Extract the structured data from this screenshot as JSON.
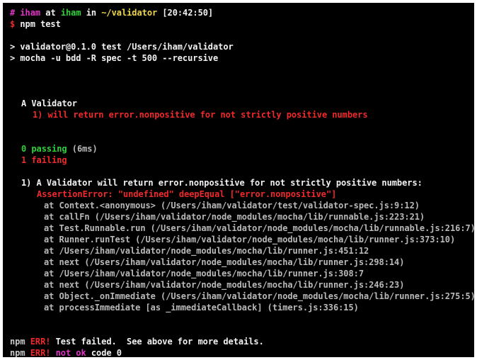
{
  "prompt": {
    "hash": "#",
    "user": "iham",
    "at": "at",
    "host": "iham",
    "in": "in",
    "cwd": "~/validator",
    "time": "[20:42:50]",
    "dollar": "$",
    "command": "npm test"
  },
  "script_header": [
    "> validator@0.1.0 test /Users/iham/validator",
    "> mocha -u bdd -R spec -t 500 --recursive"
  ],
  "suite": {
    "title": "A Validator",
    "failure_line": "1) will return error.nonpositive for not strictly positive numbers"
  },
  "summary": {
    "passing": "0 passing",
    "duration": "(6ms)",
    "failing": "1 failing"
  },
  "failure": {
    "heading": "1) A Validator will return error.nonpositive for not strictly positive numbers:",
    "error": "AssertionError: \"undefined\" deepEqual [\"error.nonpositive\"]",
    "stack": [
      "at Context.<anonymous> (/Users/iham/validator/test/validator-spec.js:9:12)",
      "at callFn (/Users/iham/validator/node_modules/mocha/lib/runnable.js:223:21)",
      "at Test.Runnable.run (/Users/iham/validator/node_modules/mocha/lib/runnable.js:216:7)",
      "at Runner.runTest (/Users/iham/validator/node_modules/mocha/lib/runner.js:373:10)",
      "at /Users/iham/validator/node_modules/mocha/lib/runner.js:451:12",
      "at next (/Users/iham/validator/node_modules/mocha/lib/runner.js:298:14)",
      "at /Users/iham/validator/node_modules/mocha/lib/runner.js:308:7",
      "at next (/Users/iham/validator/node_modules/mocha/lib/runner.js:246:23)",
      "at Object._onImmediate (/Users/iham/validator/node_modules/mocha/lib/runner.js:275:5)",
      "at processImmediate [as _immediateCallback] (timers.js:336:15)"
    ]
  },
  "npm_errors": {
    "line1": {
      "prefix": "npm",
      "tag": "ERR!",
      "message": "Test failed.  See above for more details."
    },
    "line2": {
      "prefix": "npm",
      "tag": "ERR!",
      "status": "not ok",
      "code": "code 0"
    }
  },
  "colors": {
    "background": "#000000",
    "prompt_magenta": "#e034c8",
    "green": "#2fd13b",
    "red": "#ef2a2a",
    "yellow": "#f0d64a",
    "text": "#f2f2f2",
    "stack_gray": "#b9b9b9"
  }
}
